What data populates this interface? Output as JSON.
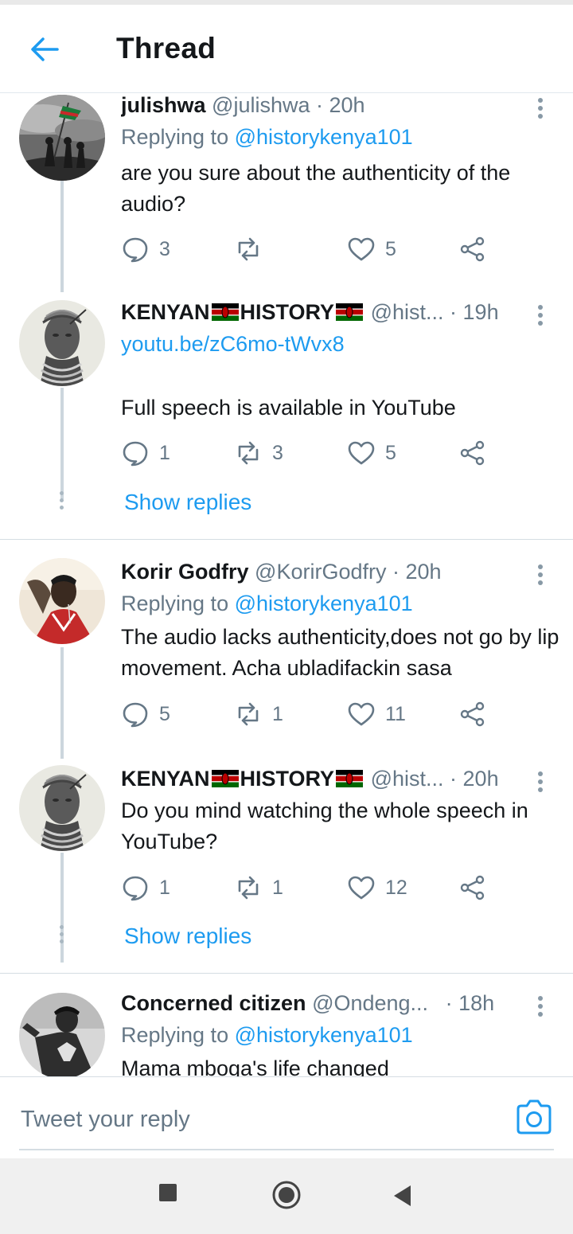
{
  "header": {
    "title": "Thread"
  },
  "tweets": [
    {
      "name": "julishwa",
      "handle": "@julishwa",
      "time": "· 20h",
      "reply_prefix": "Replying to",
      "reply_handle": "@historykenya101",
      "text": "are you sure about the authenticity of the audio?",
      "replies": "3",
      "retweets": "",
      "likes": "5"
    },
    {
      "name": "KENYAN",
      "name2": "HISTORY",
      "handle": "@hist...",
      "time": "· 19h",
      "link": "youtu.be/zC6mo-tWvx8",
      "text": "Full speech is available in YouTube",
      "replies": "1",
      "retweets": "3",
      "likes": "5"
    },
    {
      "name": "Korir Godfry",
      "handle": "@KorirGodfry",
      "time": "· 20h",
      "reply_prefix": "Replying to",
      "reply_handle": "@historykenya101",
      "text": "The audio lacks authenticity,does not go by lip movement. Acha ubladifackin sasa",
      "replies": "5",
      "retweets": "1",
      "likes": "11"
    },
    {
      "name": "KENYAN",
      "name2": "HISTORY",
      "handle": "@hist...",
      "time": "· 20h",
      "text": "Do you mind watching the whole speech in YouTube?",
      "replies": "1",
      "retweets": "1",
      "likes": "12"
    },
    {
      "name": "Concerned citizen",
      "handle": "@Ondeng...",
      "time": "· 18h",
      "reply_prefix": "Replying to",
      "reply_handle": "@historykenya101",
      "text": "Mama mboga's life changed"
    }
  ],
  "show_replies_label": "Show replies",
  "composer": {
    "placeholder": "Tweet your reply"
  },
  "icons": {
    "back": "back-arrow-icon",
    "more": "more-vertical-icon",
    "reply": "reply-bubble-icon",
    "retweet": "retweet-icon",
    "like": "heart-icon",
    "share": "share-icon",
    "camera": "camera-icon",
    "flag": "kenya-flag-icon"
  },
  "colors": {
    "accent": "#1d9bf0",
    "muted": "#657786",
    "text": "#14171a"
  }
}
